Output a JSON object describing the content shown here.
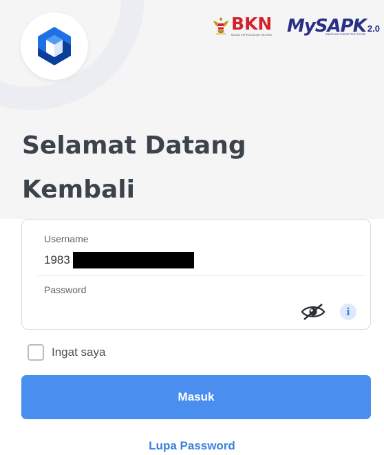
{
  "header": {
    "app_logo": "app-cube-logo",
    "bkn": {
      "title": "BKN",
      "subtitle": "BADAN KEPEGAWAIAN NEGARA"
    },
    "mysapk": {
      "title": "MySAPK",
      "version": "2.0",
      "tagline": "SMART ASN FOR BETTER FUTURE"
    }
  },
  "greeting": {
    "line1": "Selamat Datang",
    "line2": "Kembali"
  },
  "form": {
    "username": {
      "label": "Username",
      "value": "1983"
    },
    "password": {
      "label": "Password",
      "value": ""
    },
    "remember_label": "Ingat saya",
    "remember_checked": false,
    "submit_label": "Masuk",
    "forgot_label": "Lupa Password"
  },
  "colors": {
    "primary": "#4a8ff0",
    "link": "#3b80dd",
    "bkn_red": "#d2232a",
    "mysapk_navy": "#2a2f86"
  },
  "icons": [
    "app-cube-logo",
    "garuda-emblem-icon",
    "eye-slash-icon",
    "info-icon"
  ]
}
